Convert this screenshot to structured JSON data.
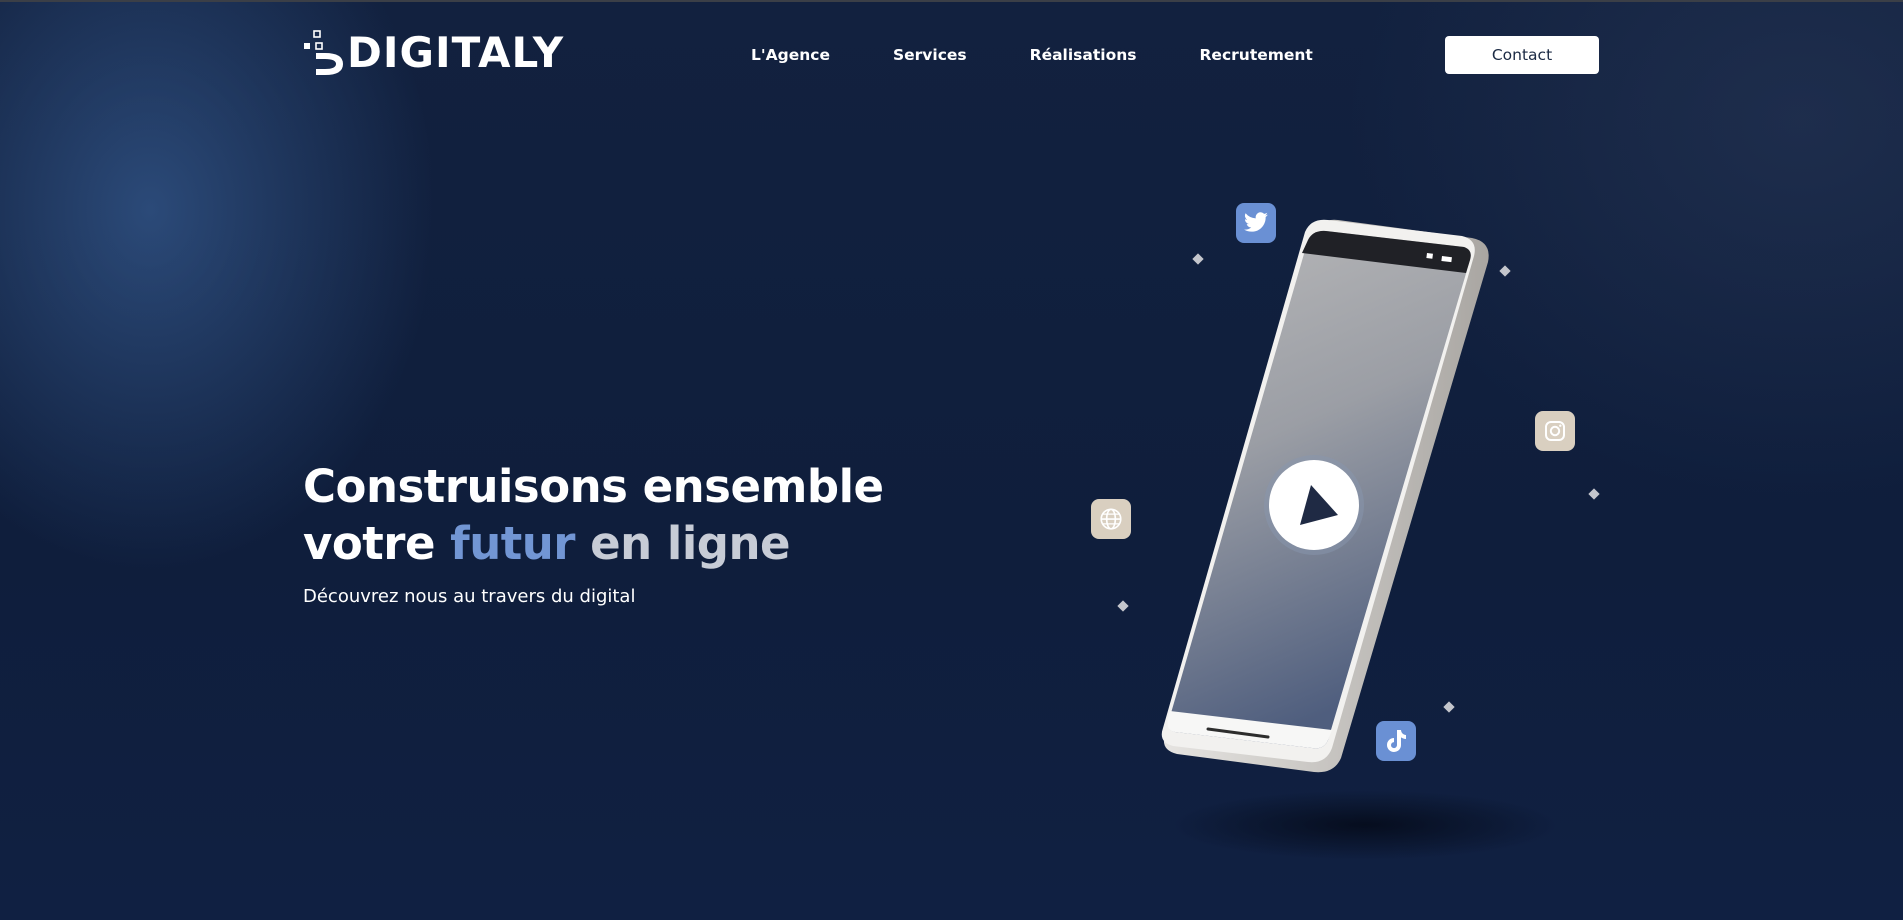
{
  "brand": {
    "name": "DIGITALY"
  },
  "nav": {
    "items": [
      "L'Agence",
      "Services",
      "Réalisations",
      "Recrutement"
    ],
    "contact_label": "Contact"
  },
  "hero": {
    "title_line1": "Construisons ensemble",
    "title_line2_start": "votre ",
    "title_word_accent1": "futur",
    "title_word_accent2": " en ligne",
    "subtitle": "Découvrez nous au travers du digital"
  },
  "illustration": {
    "icons": [
      "twitter-icon",
      "instagram-icon",
      "globe-icon",
      "tiktok-icon",
      "play-icon"
    ]
  },
  "colors": {
    "background": "#101f3d",
    "accent_blue": "#7296d4",
    "accent_gray": "#c7ccd6",
    "icon_blue": "#6a90d4",
    "icon_beige": "#d9cfc0",
    "button_bg": "#ffffff"
  }
}
